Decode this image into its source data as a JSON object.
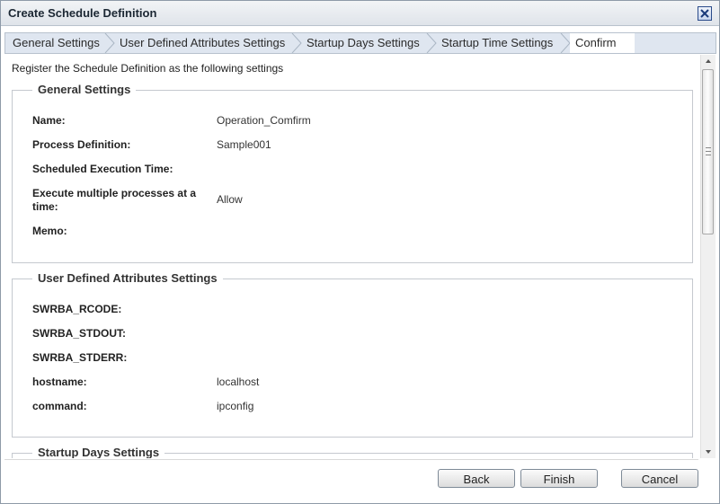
{
  "dialog": {
    "title": "Create Schedule Definition",
    "close_icon": "close-icon"
  },
  "tabs": [
    {
      "label": "General Settings"
    },
    {
      "label": "User Defined Attributes Settings"
    },
    {
      "label": "Startup Days Settings"
    },
    {
      "label": "Startup Time Settings"
    },
    {
      "label": "Confirm",
      "active": true
    }
  ],
  "intro": "Register the Schedule Definition as the following settings",
  "general": {
    "title": "General Settings",
    "rows": [
      {
        "label": "Name:",
        "value": "Operation_Comfirm"
      },
      {
        "label": "Process Definition:",
        "value": "Sample001"
      },
      {
        "label": "Scheduled Execution Time:",
        "value": ""
      },
      {
        "label": "Execute multiple processes at a time:",
        "value": "Allow"
      },
      {
        "label": "Memo:",
        "value": ""
      }
    ]
  },
  "user_attrs": {
    "title": "User Defined Attributes Settings",
    "rows": [
      {
        "label": "SWRBA_RCODE:",
        "value": ""
      },
      {
        "label": "SWRBA_STDOUT:",
        "value": ""
      },
      {
        "label": "SWRBA_STDERR:",
        "value": ""
      },
      {
        "label": "hostname:",
        "value": "localhost"
      },
      {
        "label": "command:",
        "value": "ipconfig"
      }
    ]
  },
  "startup_days": {
    "title": "Startup Days Settings"
  },
  "buttons": {
    "back": "Back",
    "finish": "Finish",
    "cancel": "Cancel"
  },
  "colors": {
    "title_bar": "#dfe4ea",
    "tab_bar": "#dfe6f0",
    "close_button_border": "#2a4b8a"
  }
}
